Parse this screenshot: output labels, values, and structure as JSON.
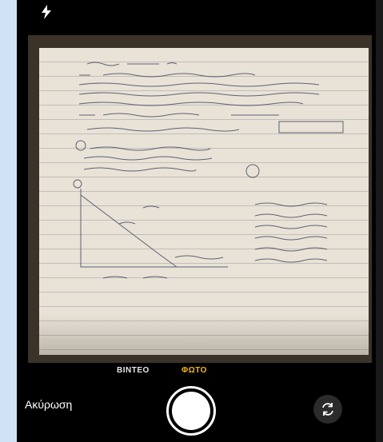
{
  "camera": {
    "modes": [
      {
        "label": "ΒΙΝΤΕΟ",
        "active": false
      },
      {
        "label": "ΦΩΤΟ",
        "active": true
      }
    ],
    "cancel_label": "Ακύρωση",
    "active_mode_color": "#f3b800"
  },
  "icons": {
    "flash": "flash-icon",
    "shutter": "shutter-button",
    "switch_camera": "camera-switch-icon"
  }
}
